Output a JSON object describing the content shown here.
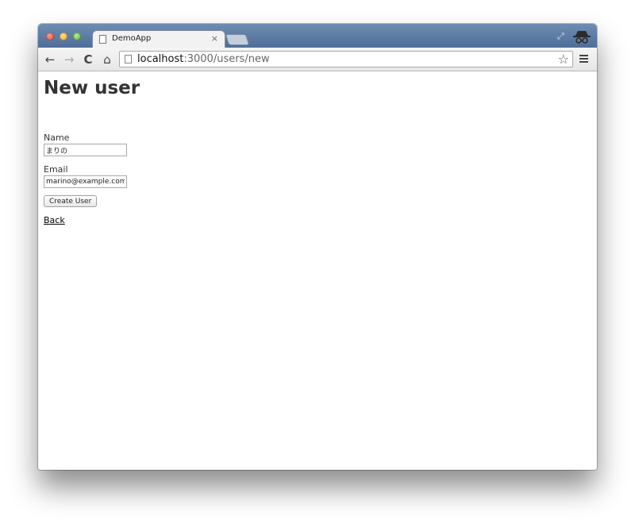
{
  "browser": {
    "tab": {
      "title": "DemoApp",
      "close_glyph": "×"
    },
    "nav": {
      "back_icon": "←",
      "forward_icon": "→",
      "reload_icon": "C",
      "home_icon": "⌂"
    },
    "address": {
      "host": "localhost",
      "rest": ":3000/users/new",
      "star_icon": "☆"
    },
    "maximize_icon": "⤢"
  },
  "page": {
    "title": "New user",
    "form": {
      "name_label": "Name",
      "name_value": "まりの",
      "email_label": "Email",
      "email_value": "marino@example.com",
      "submit_label": "Create User"
    },
    "back_link": "Back"
  }
}
